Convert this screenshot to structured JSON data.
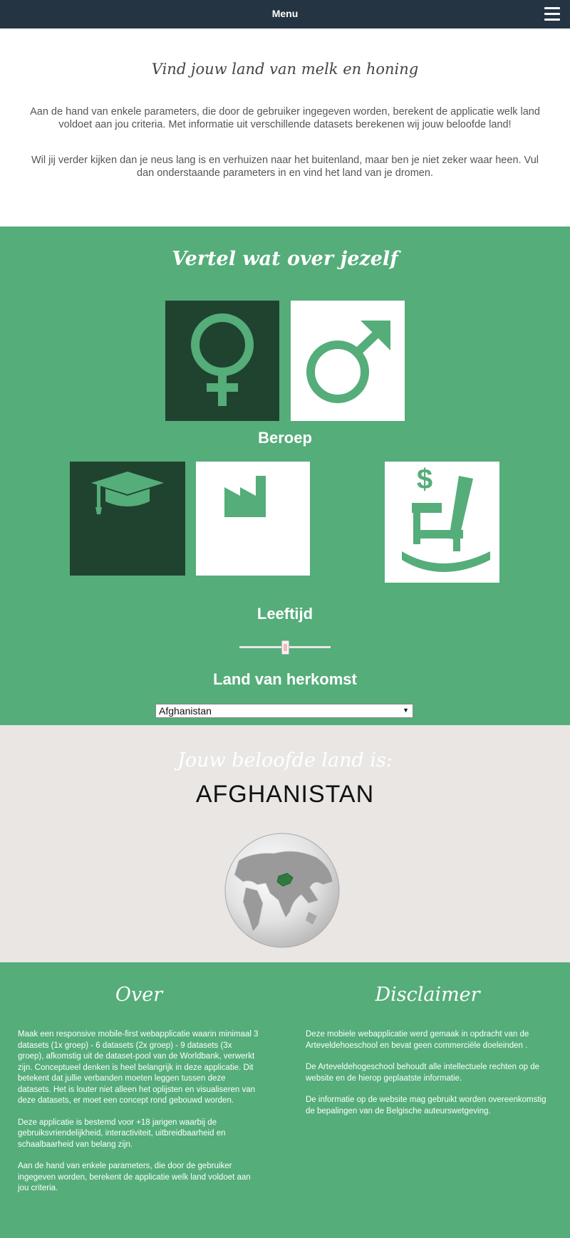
{
  "header": {
    "menu_label": "Menu"
  },
  "intro": {
    "title": "Vind jouw land van melk en honing",
    "paragraph1": "Aan de hand van enkele parameters, die door de gebruiker ingegeven worden, berekent de applicatie welk land voldoet aan jou criteria. Met informatie uit verschillende datasets berekenen wij jouw beloofde land!",
    "paragraph2": "Wil jij verder kijken dan je neus lang is en verhuizen naar het buitenland, maar ben je niet zeker waar heen. Vul dan onderstaande parameters in en vind het land van je dromen."
  },
  "form": {
    "title": "Vertel wat over jezelf",
    "gender_options": [
      {
        "icon": "female-icon",
        "selected": true
      },
      {
        "icon": "male-icon",
        "selected": false
      }
    ],
    "profession_label": "Beroep",
    "profession_options": [
      {
        "icon": "graduation-cap-icon",
        "selected": true
      },
      {
        "icon": "factory-icon",
        "selected": false
      },
      {
        "icon": "rocking-chair-dollar-icon",
        "selected": false
      }
    ],
    "age_label": "Leeftijd",
    "age_slider_value": 0.5,
    "origin_label": "Land van herkomst",
    "origin_value": "Afghanistan"
  },
  "result": {
    "title": "Jouw beloofde land is:",
    "country": "AFGHANISTAN"
  },
  "footer": {
    "over_title": "Over",
    "over_paragraphs": [
      "Maak een responsive mobile-first webapplicatie waarin minimaal 3 datasets (1x groep) - 6 datasets (2x groep) - 9 datasets (3x groep), afkomstig uit de dataset-pool van de Worldbank, verwerkt zijn. Conceptueel denken is heel belangrijk in deze applicatie. Dit betekent dat jullie verbanden moeten leggen tussen deze datasets. Het is louter niet alleen het oplijsten en visualiseren van deze datasets, er moet een concept rond gebouwd worden.",
      "Deze applicatie is bestemd voor +18 jarigen waarbij de gebruiksvriendelijkheid, interactiviteit, uitbreidbaarheid en schaalbaarheid van belang zijn.",
      "Aan de hand van enkele parameters, die door de gebruiker ingegeven worden, berekent de applicatie welk land voldoet aan jou criteria."
    ],
    "disclaimer_title": "Disclaimer",
    "disclaimer_paragraphs": [
      "Deze mobiele webapplicatie werd gemaak in opdracht van de Arteveldehoeschool en bevat geen commerciële doeleinden .",
      "De Arteveldehogeschool behoudt alle intellectuele rechten op de website en de hierop geplaatste informatie.",
      "De informatie op de website mag gebruikt worden overeenkomstig de bepalingen van de Belgische auteurswetgeving."
    ]
  },
  "colors": {
    "green": "#55ad7a",
    "dark_green": "#20432f",
    "navbar": "#253443",
    "result_bg": "#e9e6e4"
  }
}
